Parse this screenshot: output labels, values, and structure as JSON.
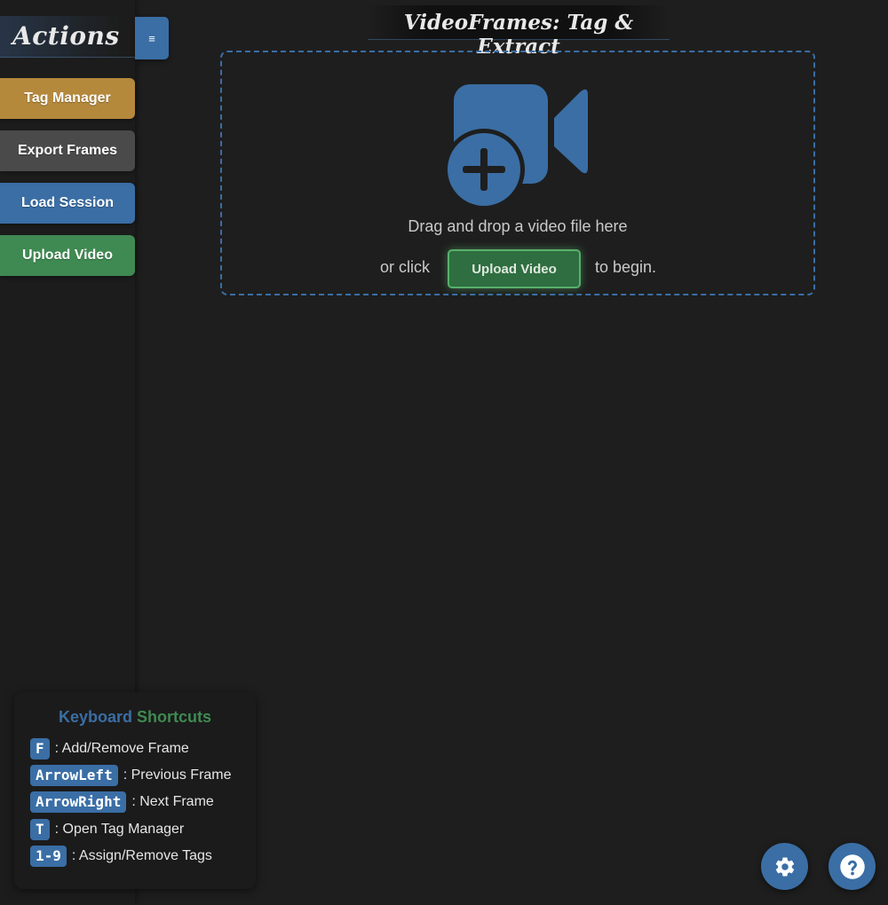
{
  "app": {
    "title": "VideoFrames: Tag & Extract"
  },
  "sidebar": {
    "title": "Actions",
    "toggle_label": "≡",
    "buttons": [
      {
        "label": "Tag Manager",
        "color": "#b5893c"
      },
      {
        "label": "Export Frames",
        "color": "#4a4a4a"
      },
      {
        "label": "Load Session",
        "color": "#3a6ea5"
      },
      {
        "label": "Upload Video",
        "color": "#3f8a52"
      }
    ]
  },
  "dropzone": {
    "icon": "video-plus-icon",
    "drag_text": "Drag and drop a video file here",
    "or_click": "or click",
    "upload_button": "Upload Video",
    "to_begin": "to begin."
  },
  "shortcuts": {
    "title_part1": "Keyboard",
    "title_part2": "Shortcuts",
    "items": [
      {
        "key": "F",
        "action": ": Add/Remove Frame"
      },
      {
        "key": "ArrowLeft",
        "action": ": Previous Frame"
      },
      {
        "key": "ArrowRight",
        "action": ": Next Frame"
      },
      {
        "key": "T",
        "action": ": Open Tag Manager"
      },
      {
        "key": "1-9",
        "action": ": Assign/Remove Tags"
      }
    ]
  },
  "floating_buttons": [
    {
      "icon": "gear-icon"
    },
    {
      "icon": "help-icon"
    }
  ],
  "colors": {
    "background": "#1e1e1e",
    "accent_blue": "#3a6ea5",
    "accent_green": "#3f8a52",
    "accent_gold": "#b5893c"
  }
}
